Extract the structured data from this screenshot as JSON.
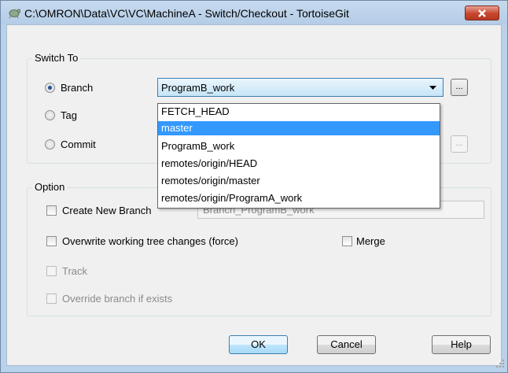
{
  "window": {
    "title": "C:\\OMRON\\Data\\VC\\VC\\MachineA - Switch/Checkout - TortoiseGit",
    "close_icon": "close-icon",
    "app_icon": "tortoisegit-icon"
  },
  "switch_to": {
    "label": "Switch To",
    "branch_label": "Branch",
    "tag_label": "Tag",
    "commit_label": "Commit",
    "selected": "Branch",
    "branch_value": "ProgramB_work",
    "browse_label": "...",
    "dropdown_items": [
      "FETCH_HEAD",
      "master",
      "ProgramB_work",
      "remotes/origin/HEAD",
      "remotes/origin/master",
      "remotes/origin/ProgramA_work"
    ],
    "highlighted_item": "master"
  },
  "option": {
    "label": "Option",
    "create_new_branch": "Create New Branch",
    "new_branch_name": "Branch_ProgramB_work",
    "overwrite": "Overwrite working tree changes (force)",
    "merge": "Merge",
    "track": "Track",
    "override": "Override branch if exists"
  },
  "buttons": {
    "ok": "OK",
    "cancel": "Cancel",
    "help": "Help"
  },
  "colors": {
    "highlight": "#3399ff",
    "title_bar": "#b9d1ea",
    "close_button": "#c8452e"
  }
}
